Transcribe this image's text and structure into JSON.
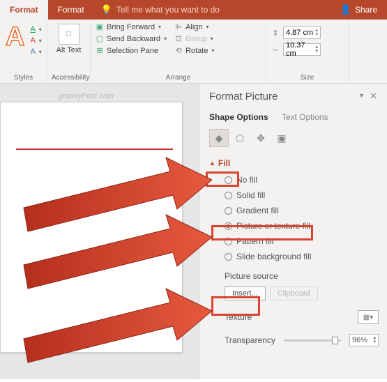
{
  "titlebar": {
    "tab1": "Format",
    "tab2": "Format",
    "tellme": "Tell me what you want to do",
    "share": "Share"
  },
  "ribbon": {
    "styles_label": "Styles",
    "accessibility_label": "Accessibility",
    "alt_text": "Alt Text",
    "arrange_label": "Arrange",
    "bring_forward": "Bring Forward",
    "send_backward": "Send Backward",
    "selection_pane": "Selection Pane",
    "align": "Align",
    "group": "Group",
    "rotate": "Rotate",
    "size_label": "Size",
    "height": "4.87 cm",
    "width": "10.37 cm"
  },
  "watermark": "groovyPost.com",
  "pane": {
    "title": "Format Picture",
    "shape_options": "Shape Options",
    "text_options": "Text Options",
    "fill_header": "Fill",
    "no_fill": "No fill",
    "solid_fill": "Solid fill",
    "gradient_fill": "Gradient fill",
    "picture_fill": "Picture or texture fill",
    "pattern_fill": "Pattern fill",
    "slide_bg_fill": "Slide background fill",
    "picture_source": "Picture source",
    "insert": "Insert...",
    "clipboard": "Clipboard",
    "texture": "Texture",
    "transparency": "Transparency",
    "transparency_value": "96%"
  }
}
